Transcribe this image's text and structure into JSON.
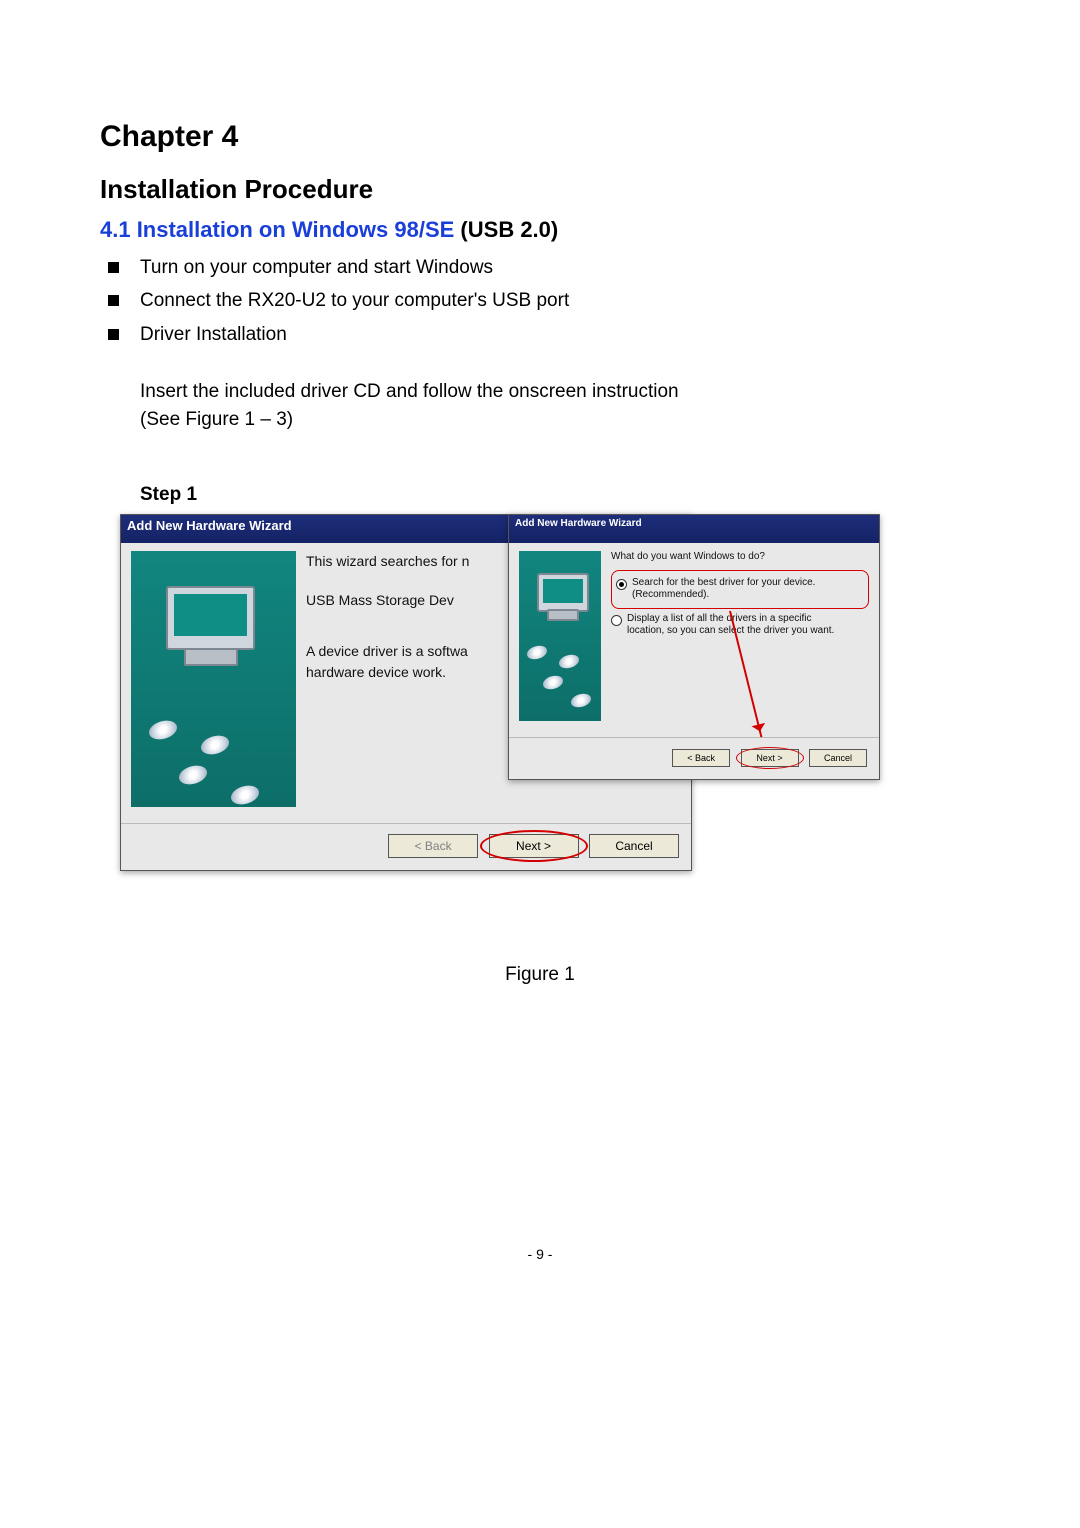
{
  "chapter": "Chapter 4",
  "title": "Installation Procedure",
  "section_prefix": "4.1 Installation on Windows 98/SE",
  "section_suffix": " (USB 2.0)",
  "bullets": [
    "Turn on your computer and start Windows",
    "Connect the RX20-U2 to your computer's USB port",
    "Driver Installation"
  ],
  "indent_line1": "Insert the included driver CD and follow the onscreen instruction",
  "indent_line2": "(See Figure 1 – 3)",
  "step_label": "Step 1",
  "wizard1": {
    "title": "Add New Hardware Wizard",
    "line1": "This wizard searches for n",
    "line2": "USB Mass Storage Dev",
    "line3": "A device driver is a softwa",
    "line4": "hardware device work.",
    "back": "< Back",
    "next": "Next >",
    "cancel": "Cancel"
  },
  "wizard2": {
    "title": "Add New Hardware Wizard",
    "prompt": "What do you want Windows to do?",
    "opt1a": "Search for the best driver for your device.",
    "opt1b": "(Recommended).",
    "opt2a": "Display a list of all the drivers in a specific",
    "opt2b": "location, so you can select the driver you want.",
    "back": "< Back",
    "next": "Next >",
    "cancel": "Cancel"
  },
  "figure_caption": "Figure 1",
  "page_number": "- 9 -"
}
